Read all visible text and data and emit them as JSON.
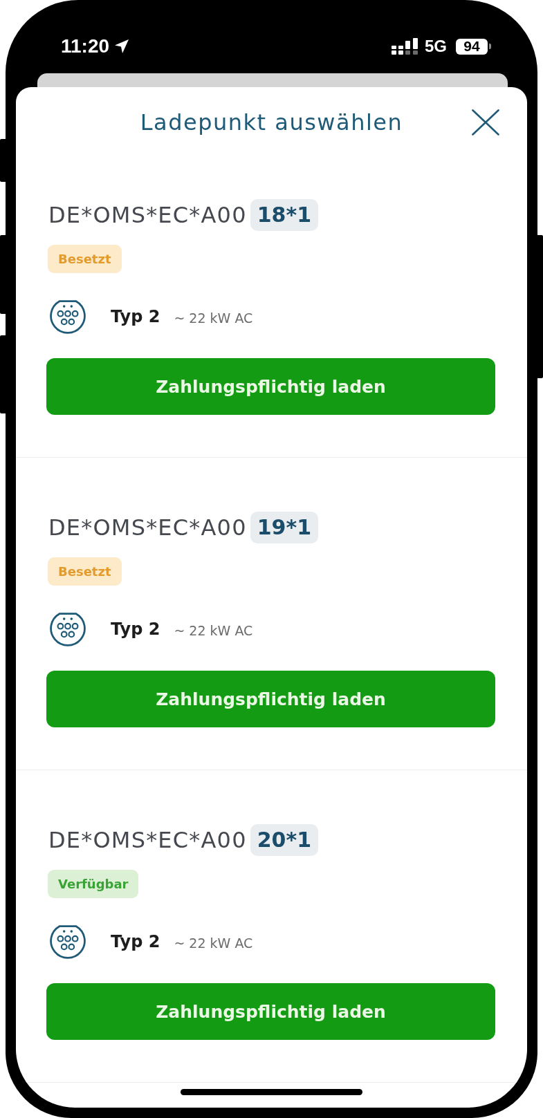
{
  "status_bar": {
    "time": "11:20",
    "network": "5G",
    "battery": "94"
  },
  "sheet": {
    "title": "Ladepunkt auswählen"
  },
  "charge_points": [
    {
      "id": "DE*OMS*EC*A00",
      "number": "18*1",
      "status": {
        "kind": "occupied",
        "label": "Besetzt"
      },
      "connector_type": "Typ 2",
      "power": "~ 22 kW AC",
      "action": "Zahlungspflichtig laden"
    },
    {
      "id": "DE*OMS*EC*A00",
      "number": "19*1",
      "status": {
        "kind": "occupied",
        "label": "Besetzt"
      },
      "connector_type": "Typ 2",
      "power": "~ 22 kW AC",
      "action": "Zahlungspflichtig laden"
    },
    {
      "id": "DE*OMS*EC*A00",
      "number": "20*1",
      "status": {
        "kind": "available",
        "label": "Verfügbar"
      },
      "connector_type": "Typ 2",
      "power": "~ 22 kW AC",
      "action": "Zahlungspflichtig laden"
    }
  ]
}
